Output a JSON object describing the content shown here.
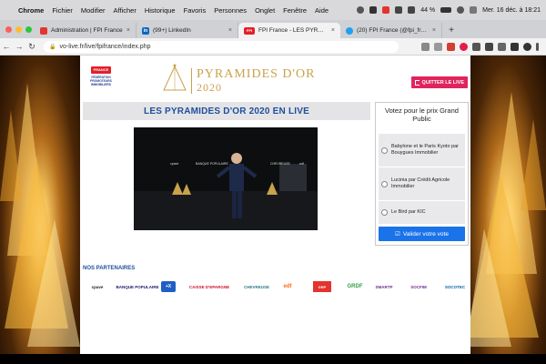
{
  "menubar": {
    "app_name": "Chrome",
    "items": [
      "Fichier",
      "Modifier",
      "Afficher",
      "Historique",
      "Favoris",
      "Personnes",
      "Onglet",
      "Fenêtre",
      "Aide"
    ],
    "battery": "44 %",
    "datetime": "Mer. 16 déc. à 18:21"
  },
  "tabs": [
    {
      "title": "Administration | FPI France",
      "favicon": "gear-icon",
      "fav_text": "",
      "color": "#e3342f",
      "active": false
    },
    {
      "title": "(99+) LinkedIn",
      "favicon": "linkedin-icon",
      "fav_text": "in",
      "color": "#0a66c2",
      "active": false
    },
    {
      "title": "FPI France - LES PYRAMIDES D'OR 2020",
      "favicon": "fpi-icon",
      "fav_text": "FPI",
      "color": "#e2202a",
      "active": true
    },
    {
      "title": "(20) FPI France (@fpi_fr) / Twitter",
      "favicon": "twitter-icon",
      "fav_text": "",
      "color": "#1da1f2",
      "active": false
    }
  ],
  "url": "vo-live.fr/live/fpifrance/index.php",
  "header": {
    "brand_line1": "PYRAMIDES D'OR",
    "brand_line2": "2020",
    "ffpi_flag": "FRANCE",
    "ffpi_text": "FÉDÉRATION PROMOTEURS IMMOBILIERS",
    "quit_label": "QUITTER LE LIVE"
  },
  "main": {
    "title": "LES PYRAMIDES D'OR 2020 EN LIVE",
    "video_labels": [
      "cpave",
      "BANQUE POPULAIRE",
      "CHEVREUSE",
      "edf"
    ]
  },
  "vote": {
    "title": "Votez pour le prix Grand Public",
    "options": [
      "Babylone et le Paris Kyoto par Bouygues Immobilier",
      "Lucinia par Crédit Agricole Immobilier",
      "Le Bird par KIC"
    ],
    "submit_label": "Valider votre vote"
  },
  "partners": {
    "title": "NOS PARTENAIRES",
    "logos": [
      {
        "label": "cpave",
        "color": "#222"
      },
      {
        "label": "BANQUE POPULAIRE",
        "color": "#1a1a6e"
      },
      {
        "label": "+X",
        "color": "#1f5fc4"
      },
      {
        "label": "CAISSE D'EPARGNE",
        "color": "#d0102c"
      },
      {
        "label": "CHEVREUSE",
        "color": "#2b7a8a"
      },
      {
        "label": "edf",
        "color": "#ff6a13"
      },
      {
        "label": "GRP",
        "color": "#e3342f"
      },
      {
        "label": "GRDF",
        "color": "#2f9e44"
      },
      {
        "label": "SMARTP",
        "color": "#6d2c91"
      },
      {
        "label": "SOCFIM",
        "color": "#6d2c91"
      },
      {
        "label": "SOCOTEC",
        "color": "#0061a8"
      }
    ]
  },
  "colors": {
    "brand_gold": "#c9a24a",
    "title_blue": "#1f4e9c",
    "quit_pink": "#e0245e",
    "submit_blue": "#1a73e8"
  }
}
